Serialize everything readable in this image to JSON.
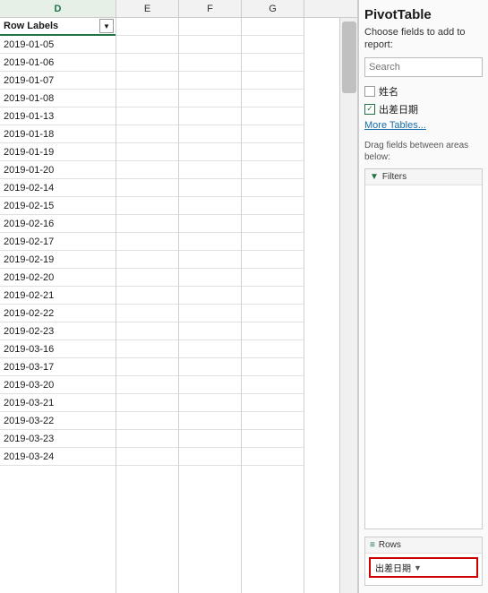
{
  "spreadsheet": {
    "columns": {
      "D": "D",
      "E": "E",
      "F": "F",
      "G": "G"
    },
    "header_cell": {
      "label": "Row Labels",
      "dropdown": "▼"
    },
    "rows": [
      "2019-01-05",
      "2019-01-06",
      "2019-01-07",
      "2019-01-08",
      "2019-01-13",
      "2019-01-18",
      "2019-01-19",
      "2019-01-20",
      "2019-02-14",
      "2019-02-15",
      "2019-02-16",
      "2019-02-17",
      "2019-02-19",
      "2019-02-20",
      "2019-02-21",
      "2019-02-22",
      "2019-02-23",
      "2019-03-16",
      "2019-03-17",
      "2019-03-20",
      "2019-03-21",
      "2019-03-22",
      "2019-03-23",
      "2019-03-24"
    ]
  },
  "pivot": {
    "title": "PivotTable",
    "subtitle": "Choose fields to add to report:",
    "search_placeholder": "Search",
    "fields": [
      {
        "label": "姓名",
        "checked": false
      },
      {
        "label": "出差日期",
        "checked": true
      }
    ],
    "more_tables": "More Tables...",
    "drag_label": "Drag fields between areas below:",
    "filters_label": "Filters",
    "rows_label": "Rows",
    "row_chip": "出差日期",
    "chip_dropdown": "▼"
  }
}
